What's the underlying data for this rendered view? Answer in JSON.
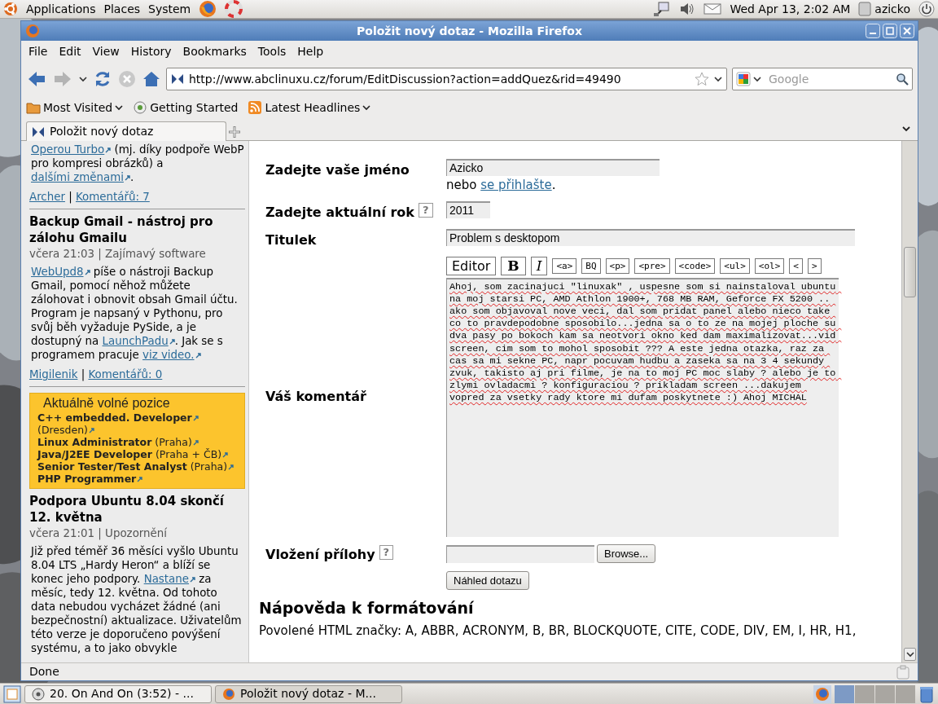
{
  "top_panel": {
    "menus": [
      "Applications",
      "Places",
      "System"
    ],
    "clock": "Wed Apr 13,  2:02 AM",
    "user": "azicko"
  },
  "window": {
    "title": "Položit nový dotaz - Mozilla Firefox"
  },
  "menu_bar": [
    "File",
    "Edit",
    "View",
    "History",
    "Bookmarks",
    "Tools",
    "Help"
  ],
  "address_bar": {
    "value": "http://www.abclinuxu.cz/forum/EditDiscussion?action=addQuez&rid=49490"
  },
  "search_field": {
    "placeholder": "Google"
  },
  "bookmarks": [
    {
      "label": "Most Visited",
      "kind": "folder",
      "dropdown": true
    },
    {
      "label": "Getting Started",
      "kind": "page",
      "dropdown": false
    },
    {
      "label": "Latest Headlines",
      "kind": "feed",
      "dropdown": true
    }
  ],
  "tabs": [
    {
      "label": "Položit nový dotaz",
      "selected": true
    }
  ],
  "sidebar": {
    "blocks": [
      {
        "kind": "article",
        "body": [
          {
            "kind": "ext_link",
            "text": "Operou Turbo"
          },
          {
            "kind": "text",
            "text": " (mj. díky podpoře WebP pro kompresi obrázků) a "
          },
          {
            "kind": "ext_link",
            "text": "dalšími změnami"
          },
          {
            "kind": "text",
            "text": "."
          }
        ],
        "footer": [
          {
            "kind": "link",
            "text": "Archer"
          },
          {
            "kind": "text",
            "text": " | "
          },
          {
            "kind": "link",
            "text": "Komentářů: 7"
          }
        ]
      },
      {
        "kind": "article",
        "title": "Backup Gmail - nástroj pro zálohu Gmailu",
        "meta": "včera 21:03 | Zajímavý software",
        "body": [
          {
            "kind": "ext_link",
            "text": "WebUpd8"
          },
          {
            "kind": "text",
            "text": " píše o nástroji Backup Gmail, pomocí něhož můžete zálohovat i obnovit obsah Gmail účtu. Program je napsaný v Pythonu, pro svůj běh vyžaduje PySide, a je dostupný na "
          },
          {
            "kind": "ext_link",
            "text": "LaunchPadu"
          },
          {
            "kind": "text",
            "text": ". Jak se s programem pracuje "
          },
          {
            "kind": "ext_link",
            "text": "viz video."
          }
        ],
        "footer": [
          {
            "kind": "link",
            "text": "Migilenik"
          },
          {
            "kind": "text",
            "text": " | "
          },
          {
            "kind": "link",
            "text": "Komentářů: 0"
          }
        ]
      },
      {
        "kind": "jobs",
        "title": "Aktuálně volné pozice",
        "items": [
          "**C++ embedded. Developer**",
          "(Dresden)",
          "**Linux Administrator** (Praha)",
          "**Java/J2EE Developer** (Praha + ČB)",
          "**Senior Tester/Test Analyst** (Praha)",
          "**PHP Programmer**"
        ]
      },
      {
        "kind": "article",
        "title": "Podpora Ubuntu 8.04 skončí 12. května",
        "meta": "včera 21:01 | Upozornění",
        "body": [
          {
            "kind": "text",
            "text": "Již před téměř 36 měsíci vyšlo Ubuntu 8.04 LTS „Hardy Heron“ a blíží se konec jeho podpory. "
          },
          {
            "kind": "ext_link",
            "text": "Nastane"
          },
          {
            "kind": "text",
            "text": " za měsíc, tedy 12. května. Od tohoto data nebudou vycházet žádné (ani bezpečnostní) aktualizace. Uživatelům této verze je doporučeno povýšení systému, a to jako obvykle"
          }
        ]
      }
    ]
  },
  "main": {
    "form": [
      {
        "kind": "input",
        "label": "Zadejte vaše jméno",
        "value": "Azicko",
        "note": [
          {
            "kind": "text",
            "text": "nebo "
          },
          {
            "kind": "link",
            "text": "se přihlašte"
          },
          {
            "kind": "text",
            "text": "."
          }
        ]
      },
      {
        "kind": "input",
        "label": "Zadejte aktuální rok",
        "help": "?",
        "value": "2011"
      },
      {
        "kind": "input",
        "label": "Titulek",
        "value": "Problem s desktopom"
      },
      {
        "kind": "editor",
        "label": "Váš komentář",
        "tools": [
          {
            "label": "Editor",
            "kind": "text"
          },
          {
            "label": "B",
            "kind": "bold"
          },
          {
            "label": "I",
            "kind": "italic"
          },
          {
            "label": "<a>",
            "kind": "code"
          },
          {
            "label": "BQ",
            "kind": "code"
          },
          {
            "label": "<p>",
            "kind": "code"
          },
          {
            "label": "<pre>",
            "kind": "code"
          },
          {
            "label": "<code>",
            "kind": "code"
          },
          {
            "label": "<ul>",
            "kind": "code"
          },
          {
            "label": "<ol>",
            "kind": "code"
          },
          {
            "label": "<",
            "kind": "code"
          },
          {
            "label": ">",
            "kind": "code"
          }
        ],
        "value": "Ahoj, som zacinajuci \"linuxak\" , uspesne som si nainstaloval ubuntu na moj starsi PC, AMD Athlon 1900+, 768 MB RAM, Geforce FX 5200 .. ako som objavoval nove veci, dal som pridat panel alebo nieco take co to pravdepodobne sposobilo...jedna sa o to ze na mojej ploche su dva pasy po bokoch kam sa neotvori okno ked dam maximalizovat...vid screen, cim som to mohol sposobit ??? A este jedna otazka, raz za cas sa mi sekne PC, napr pocuvam hudbu a zaseka sa na 3 4 sekundy zvuk, takisto aj pri filme, je na to moj PC moc slaby ? alebo je to zlymi ovladacmi ? konfiguraciou ? prikladam screen ...dakujem vopred za vsetky rady ktore mi dufam poskytnete :) Ahoj MICHAL"
      },
      {
        "kind": "file",
        "label": "Vložení přílohy",
        "help": "?",
        "button": "Browse..."
      },
      {
        "kind": "submit",
        "button": "Náhled dotazu"
      }
    ],
    "help_heading": "Nápověda k formátování",
    "help_text": [
      {
        "kind": "text",
        "text": "Povolené HTML značky: A, ABBR, ACRONYM, B, BR, BLOCKQUOTE, CITE, CODE, DIV, EM, I, HR, H1,"
      }
    ]
  },
  "status_bar": "Done",
  "taskbar": [
    {
      "label": "20. On And On (3:52) - ...",
      "kind": "music",
      "selected": false
    },
    {
      "label": "Položit nový dotaz - M...",
      "kind": "browser",
      "selected": true
    }
  ]
}
